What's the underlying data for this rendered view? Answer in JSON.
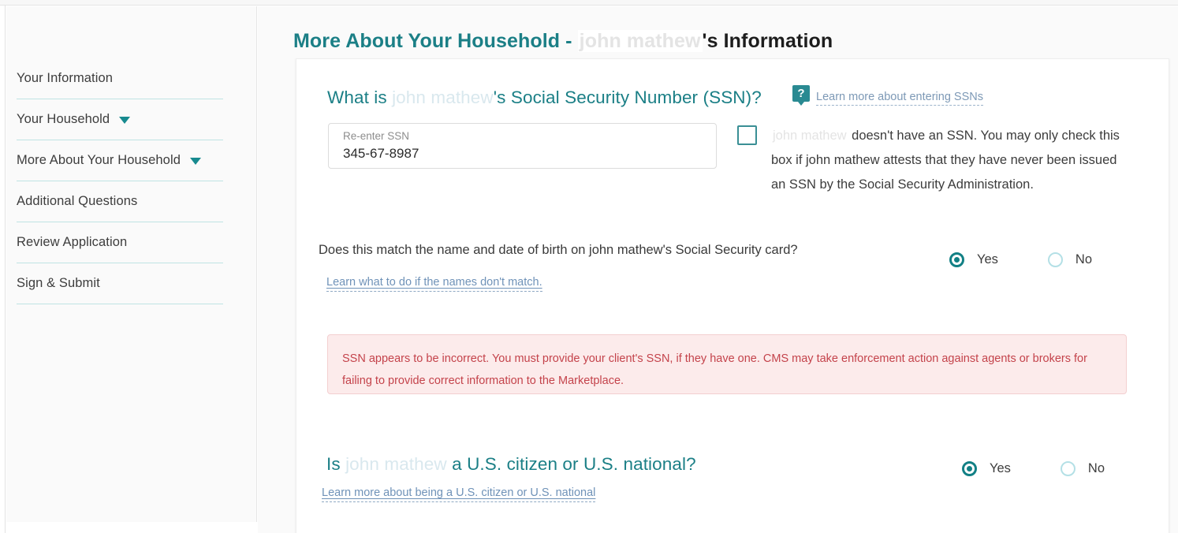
{
  "page": {
    "title_prefix": "More About Your Household - ",
    "title_name": "john mathew",
    "title_suffix": "'s Information"
  },
  "sidebar": {
    "items": [
      {
        "label": "Your Information",
        "caret": false
      },
      {
        "label": "Your Household",
        "caret": true
      },
      {
        "label": "More About Your Household",
        "caret": true
      },
      {
        "label": "Additional Questions",
        "caret": false
      },
      {
        "label": "Review Application",
        "caret": false
      },
      {
        "label": "Sign & Submit",
        "caret": false
      }
    ],
    "caret_icon": "chevron-down-icon"
  },
  "ssn_question": {
    "prefix": "What is ",
    "name": "john mathew",
    "suffix": "'s Social Security Number (SSN)?",
    "help_icon": "question-mark-help-icon",
    "help_icon_glyph": "?",
    "help_link": "Learn more about entering SSNs",
    "input": {
      "label": "Re-enter SSN",
      "value": "345-67-8987",
      "placeholder": "Re-enter SSN"
    },
    "checkbox": {
      "checked": false,
      "name": "john mathew",
      "text": " doesn't have an SSN. You may only check this box if john mathew attests that they have never been issued an SSN by the Social Security Administration."
    }
  },
  "match_question": {
    "text": "Does this match the name and date of birth on john mathew's Social Security card?",
    "link": "Learn what to do if the names don't match.",
    "options": [
      {
        "label": "Yes",
        "selected": true
      },
      {
        "label": "No",
        "selected": false
      }
    ]
  },
  "error": {
    "message": "SSN appears to be incorrect. You must provide your client's SSN, if they have one. CMS may take enforcement action against agents or brokers for failing to provide correct information to the Marketplace."
  },
  "citizen_question": {
    "prefix": "Is ",
    "name": "john mathew",
    "suffix": " a U.S. citizen or U.S. national?",
    "link": "Learn more about being a U.S. citizen or U.S. national",
    "options": [
      {
        "label": "Yes",
        "selected": true
      },
      {
        "label": "No",
        "selected": false
      }
    ]
  },
  "colors": {
    "teal": "#1b7f86",
    "teal_accent": "#128085",
    "error_text": "#c4434b",
    "error_bg": "#fcebeb",
    "link_blue": "#6f92b8",
    "ghost_name": "#e4e4e4"
  }
}
